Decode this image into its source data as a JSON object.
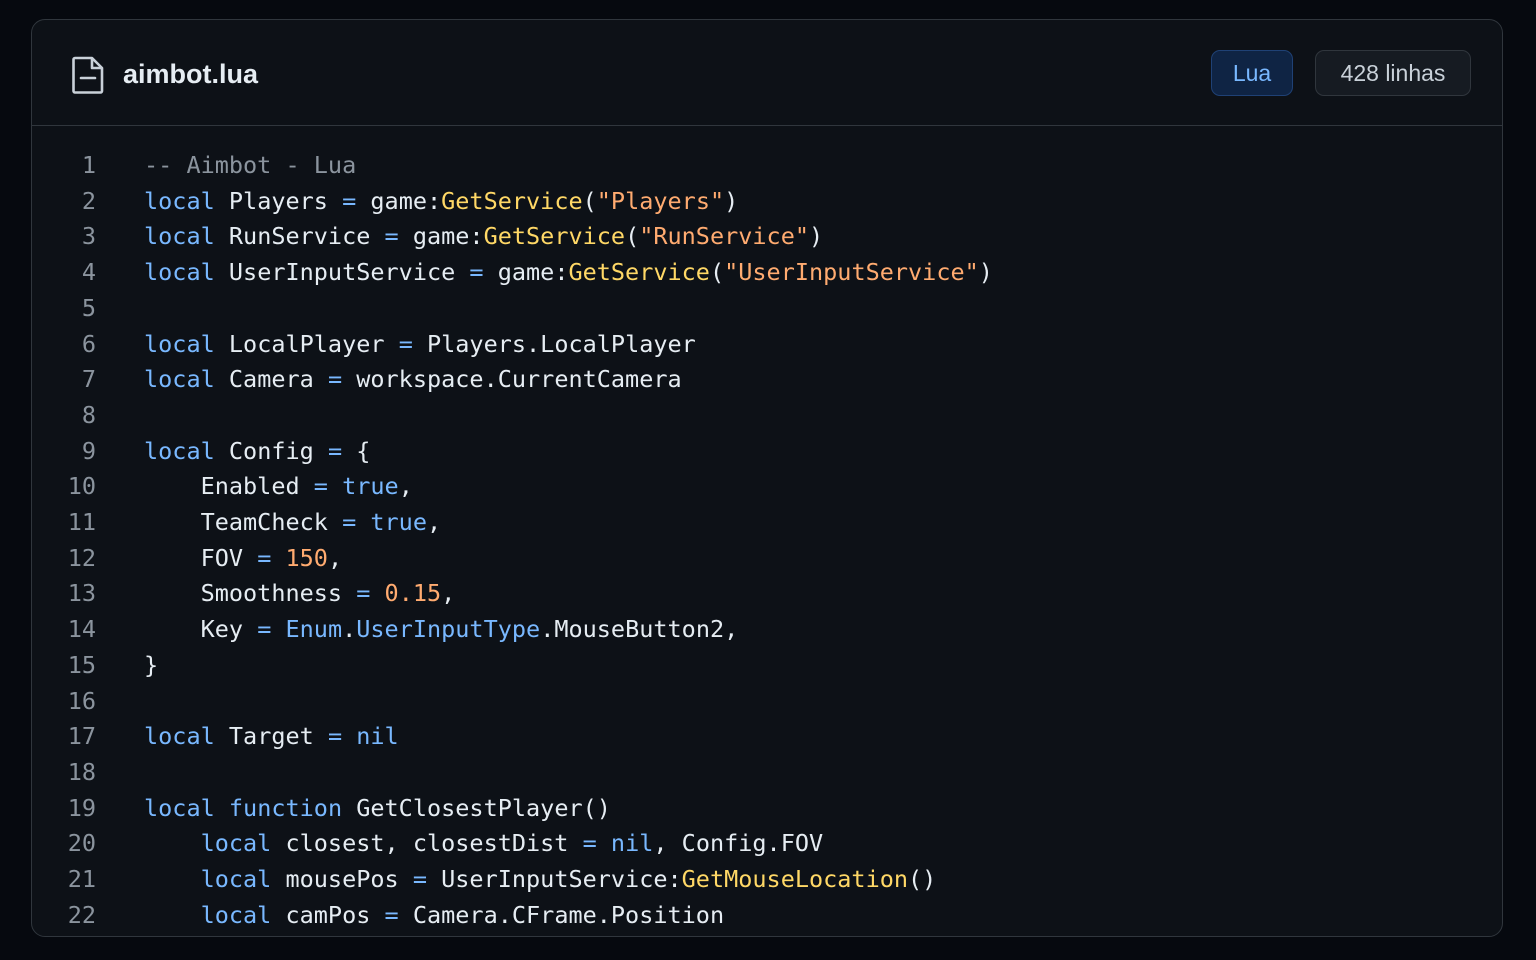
{
  "file": {
    "icon": "file-icon",
    "name": "aimbot.lua",
    "language": "Lua",
    "line_count": "428 linhas"
  },
  "code_lines": [
    {
      "n": "1",
      "tokens": [
        {
          "t": "cm",
          "v": "-- Aimbot - Lua"
        }
      ]
    },
    {
      "n": "2",
      "tokens": [
        {
          "t": "kw",
          "v": "local"
        },
        {
          "t": "plain",
          "v": " Players "
        },
        {
          "t": "op",
          "v": "="
        },
        {
          "t": "plain",
          "v": " game:"
        },
        {
          "t": "fn",
          "v": "GetService"
        },
        {
          "t": "plain",
          "v": "("
        },
        {
          "t": "str",
          "v": "\"Players\""
        },
        {
          "t": "plain",
          "v": ")"
        }
      ]
    },
    {
      "n": "3",
      "tokens": [
        {
          "t": "kw",
          "v": "local"
        },
        {
          "t": "plain",
          "v": " RunService "
        },
        {
          "t": "op",
          "v": "="
        },
        {
          "t": "plain",
          "v": " game:"
        },
        {
          "t": "fn",
          "v": "GetService"
        },
        {
          "t": "plain",
          "v": "("
        },
        {
          "t": "str",
          "v": "\"RunService\""
        },
        {
          "t": "plain",
          "v": ")"
        }
      ]
    },
    {
      "n": "4",
      "tokens": [
        {
          "t": "kw",
          "v": "local"
        },
        {
          "t": "plain",
          "v": " UserInputService "
        },
        {
          "t": "op",
          "v": "="
        },
        {
          "t": "plain",
          "v": " game:"
        },
        {
          "t": "fn",
          "v": "GetService"
        },
        {
          "t": "plain",
          "v": "("
        },
        {
          "t": "str",
          "v": "\"UserInputService\""
        },
        {
          "t": "plain",
          "v": ")"
        }
      ]
    },
    {
      "n": "5",
      "tokens": []
    },
    {
      "n": "6",
      "tokens": [
        {
          "t": "kw",
          "v": "local"
        },
        {
          "t": "plain",
          "v": " LocalPlayer "
        },
        {
          "t": "op",
          "v": "="
        },
        {
          "t": "plain",
          "v": " Players.LocalPlayer"
        }
      ]
    },
    {
      "n": "7",
      "tokens": [
        {
          "t": "kw",
          "v": "local"
        },
        {
          "t": "plain",
          "v": " Camera "
        },
        {
          "t": "op",
          "v": "="
        },
        {
          "t": "plain",
          "v": " workspace.CurrentCamera"
        }
      ]
    },
    {
      "n": "8",
      "tokens": []
    },
    {
      "n": "9",
      "tokens": [
        {
          "t": "kw",
          "v": "local"
        },
        {
          "t": "plain",
          "v": " Config "
        },
        {
          "t": "op",
          "v": "="
        },
        {
          "t": "plain",
          "v": " {"
        }
      ]
    },
    {
      "n": "10",
      "tokens": [
        {
          "t": "plain",
          "v": "    Enabled "
        },
        {
          "t": "op",
          "v": "="
        },
        {
          "t": "plain",
          "v": " "
        },
        {
          "t": "kw",
          "v": "true"
        },
        {
          "t": "plain",
          "v": ","
        }
      ]
    },
    {
      "n": "11",
      "tokens": [
        {
          "t": "plain",
          "v": "    TeamCheck "
        },
        {
          "t": "op",
          "v": "="
        },
        {
          "t": "plain",
          "v": " "
        },
        {
          "t": "kw",
          "v": "true"
        },
        {
          "t": "plain",
          "v": ","
        }
      ]
    },
    {
      "n": "12",
      "tokens": [
        {
          "t": "plain",
          "v": "    FOV "
        },
        {
          "t": "op",
          "v": "="
        },
        {
          "t": "plain",
          "v": " "
        },
        {
          "t": "num",
          "v": "150"
        },
        {
          "t": "plain",
          "v": ","
        }
      ]
    },
    {
      "n": "13",
      "tokens": [
        {
          "t": "plain",
          "v": "    Smoothness "
        },
        {
          "t": "op",
          "v": "="
        },
        {
          "t": "plain",
          "v": " "
        },
        {
          "t": "num",
          "v": "0.15"
        },
        {
          "t": "plain",
          "v": ","
        }
      ]
    },
    {
      "n": "14",
      "tokens": [
        {
          "t": "plain",
          "v": "    Key "
        },
        {
          "t": "op",
          "v": "="
        },
        {
          "t": "plain",
          "v": " "
        },
        {
          "t": "kw",
          "v": "Enum"
        },
        {
          "t": "plain",
          "v": "."
        },
        {
          "t": "kw",
          "v": "UserInputType"
        },
        {
          "t": "plain",
          "v": ".MouseButton2,"
        }
      ]
    },
    {
      "n": "15",
      "tokens": [
        {
          "t": "plain",
          "v": "}"
        }
      ]
    },
    {
      "n": "16",
      "tokens": []
    },
    {
      "n": "17",
      "tokens": [
        {
          "t": "kw",
          "v": "local"
        },
        {
          "t": "plain",
          "v": " Target "
        },
        {
          "t": "op",
          "v": "="
        },
        {
          "t": "plain",
          "v": " "
        },
        {
          "t": "kw",
          "v": "nil"
        }
      ]
    },
    {
      "n": "18",
      "tokens": []
    },
    {
      "n": "19",
      "tokens": [
        {
          "t": "kw",
          "v": "local"
        },
        {
          "t": "plain",
          "v": " "
        },
        {
          "t": "kw",
          "v": "function"
        },
        {
          "t": "plain",
          "v": " GetClosestPlayer()"
        }
      ]
    },
    {
      "n": "20",
      "tokens": [
        {
          "t": "plain",
          "v": "    "
        },
        {
          "t": "kw",
          "v": "local"
        },
        {
          "t": "plain",
          "v": " closest, closestDist "
        },
        {
          "t": "op",
          "v": "="
        },
        {
          "t": "plain",
          "v": " "
        },
        {
          "t": "kw",
          "v": "nil"
        },
        {
          "t": "plain",
          "v": ", Config.FOV"
        }
      ]
    },
    {
      "n": "21",
      "tokens": [
        {
          "t": "plain",
          "v": "    "
        },
        {
          "t": "kw",
          "v": "local"
        },
        {
          "t": "plain",
          "v": " mousePos "
        },
        {
          "t": "op",
          "v": "="
        },
        {
          "t": "plain",
          "v": " UserInputService:"
        },
        {
          "t": "fn",
          "v": "GetMouseLocation"
        },
        {
          "t": "plain",
          "v": "()"
        }
      ]
    },
    {
      "n": "22",
      "tokens": [
        {
          "t": "plain",
          "v": "    "
        },
        {
          "t": "kw",
          "v": "local"
        },
        {
          "t": "plain",
          "v": " camPos "
        },
        {
          "t": "op",
          "v": "="
        },
        {
          "t": "plain",
          "v": " Camera.CFrame.Position"
        }
      ]
    }
  ]
}
